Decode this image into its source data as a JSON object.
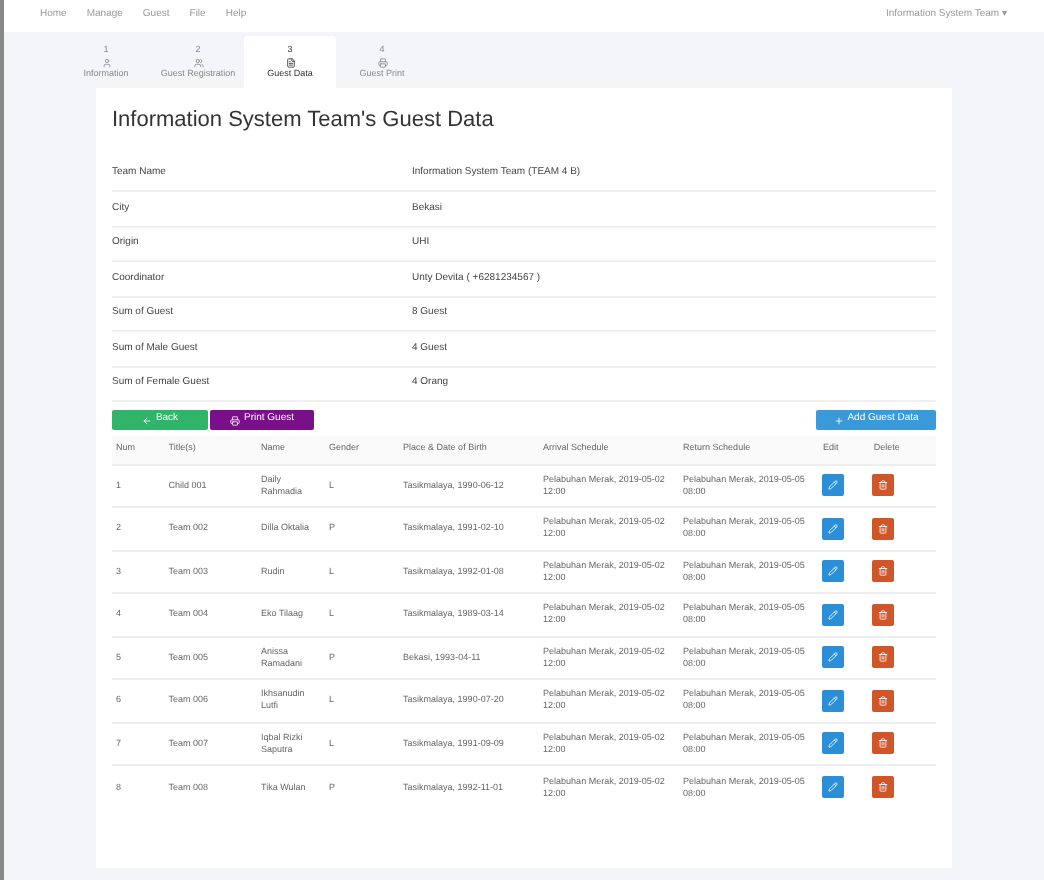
{
  "nav": {
    "items": [
      "Home",
      "Manage",
      "Guest",
      "File",
      "Help"
    ],
    "user": "Information System Team ▾"
  },
  "steps": [
    {
      "number": "1",
      "label": "Information",
      "selected": false
    },
    {
      "number": "2",
      "label": "Guest Registration",
      "selected": false
    },
    {
      "number": "3",
      "label": "Guest Data",
      "selected": true
    },
    {
      "number": "4",
      "label": "Guest Print",
      "selected": false
    }
  ],
  "title": "Information System Team's Guest Data",
  "details": [
    {
      "label": "Team Name",
      "value": "Information System Team (TEAM 4 B)"
    },
    {
      "label": "City",
      "value": "Bekasi"
    },
    {
      "label": "Origin",
      "value": "UHI"
    },
    {
      "label": "Coordinator",
      "value": "Unty Devita ( +6281234567 )"
    },
    {
      "label": "Sum of Guest",
      "value": "8 Guest"
    },
    {
      "label": "Sum of Male Guest",
      "value": "4 Guest"
    },
    {
      "label": "Sum of Female Guest",
      "value": "4 Orang"
    }
  ],
  "buttons": {
    "back": "Back",
    "print": "Print Guest",
    "add": "Add Guest Data"
  },
  "table": {
    "columns": [
      "Num",
      "Title(s)",
      "Name",
      "Gender",
      "Place & Date of Birth",
      "Arrival Schedule",
      "Return Schedule",
      "Edit",
      "Delete"
    ],
    "rows": [
      [
        "1",
        "Child 001",
        "Daily Rahmadia",
        "L",
        "Tasikmalaya, 1990-06-12",
        "Pelabuhan Merak, 2019-05-02 12:00",
        "Pelabuhan Merak, 2019-05-05 08:00"
      ],
      [
        "2",
        "Team 002",
        "Dilla Oktalia",
        "P",
        "Tasikmalaya, 1991-02-10",
        "Pelabuhan Merak, 2019-05-02 12:00",
        "Pelabuhan Merak, 2019-05-05 08:00"
      ],
      [
        "3",
        "Team 003",
        "Rudin",
        "L",
        "Tasikmalaya, 1992-01-08",
        "Pelabuhan Merak, 2019-05-02 12:00",
        "Pelabuhan Merak, 2019-05-05 08:00"
      ],
      [
        "4",
        "Team 004",
        "Eko Tilaag",
        "L",
        "Tasikmalaya, 1989-03-14",
        "Pelabuhan Merak, 2019-05-02 12:00",
        "Pelabuhan Merak, 2019-05-05 08:00"
      ],
      [
        "5",
        "Team 005",
        "Anissa Ramadani",
        "P",
        "Bekasi, 1993-04-11",
        "Pelabuhan Merak, 2019-05-02 12:00",
        "Pelabuhan Merak, 2019-05-05 08:00"
      ],
      [
        "6",
        "Team 006",
        "Ikhsanudin Lutfi",
        "L",
        "Tasikmalaya, 1990-07-20",
        "Pelabuhan Merak, 2019-05-02 12:00",
        "Pelabuhan Merak, 2019-05-05 08:00"
      ],
      [
        "7",
        "Team 007",
        "Iqbal Rizki Saputra",
        "L",
        "Tasikmalaya, 1991-09-09",
        "Pelabuhan Merak, 2019-05-02 12:00",
        "Pelabuhan Merak, 2019-05-05 08:00"
      ],
      [
        "8",
        "Team 008",
        "Tika Wulan",
        "P",
        "Tasikmalaya, 1992-11-01",
        "Pelabuhan Merak, 2019-05-02 12:00",
        "Pelabuhan Merak, 2019-05-05 08:00"
      ]
    ]
  }
}
